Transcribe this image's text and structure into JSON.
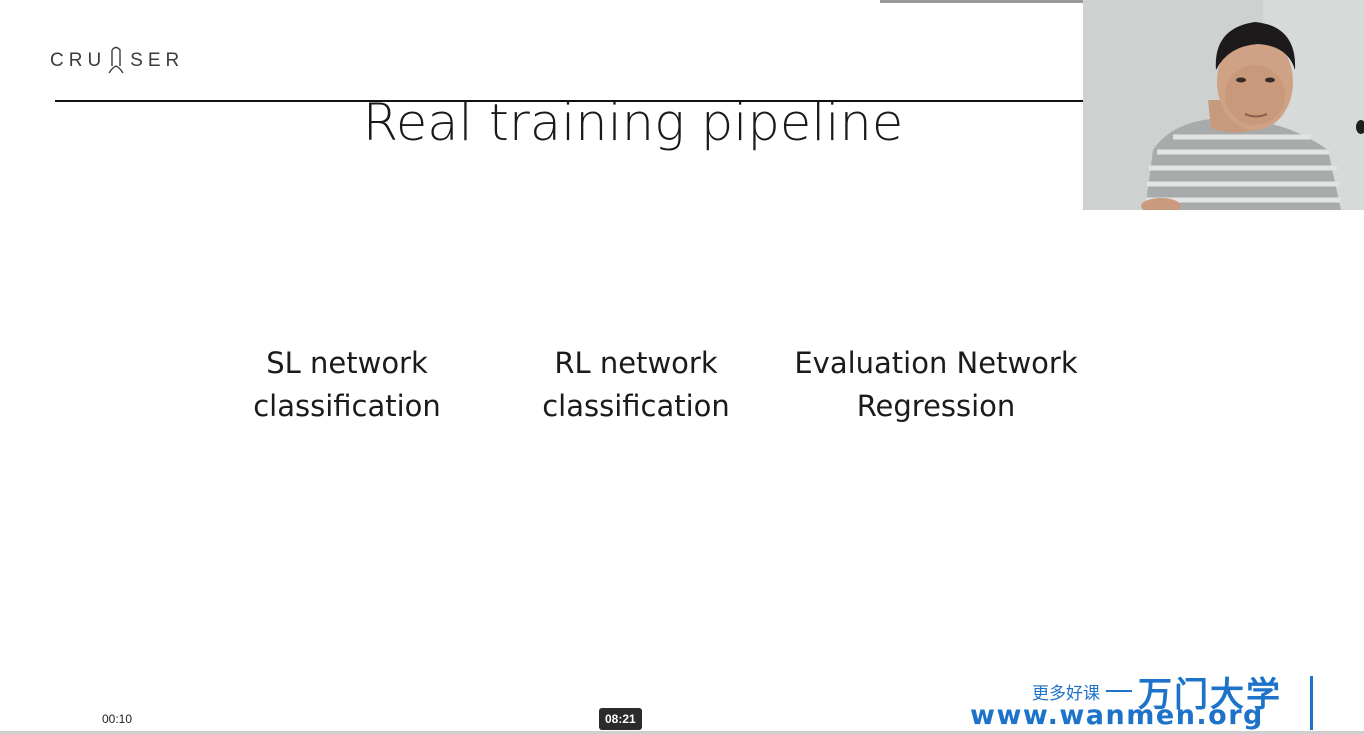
{
  "logo": {
    "left_text": "CRU",
    "right_text": "SER"
  },
  "slide": {
    "title": "Real training pipeline",
    "columns": [
      {
        "line1": "SL network",
        "line2": "classification"
      },
      {
        "line1": "RL network",
        "line2": "classification"
      },
      {
        "line1": "Evaluation Network",
        "line2": "Regression"
      }
    ]
  },
  "player": {
    "current_time": "00:10",
    "hover_time": "08:21"
  },
  "watermark": {
    "tagline": "更多好课",
    "brand": "万门大学",
    "url": "www.wanmen.org",
    "color": "#1d73c9"
  }
}
